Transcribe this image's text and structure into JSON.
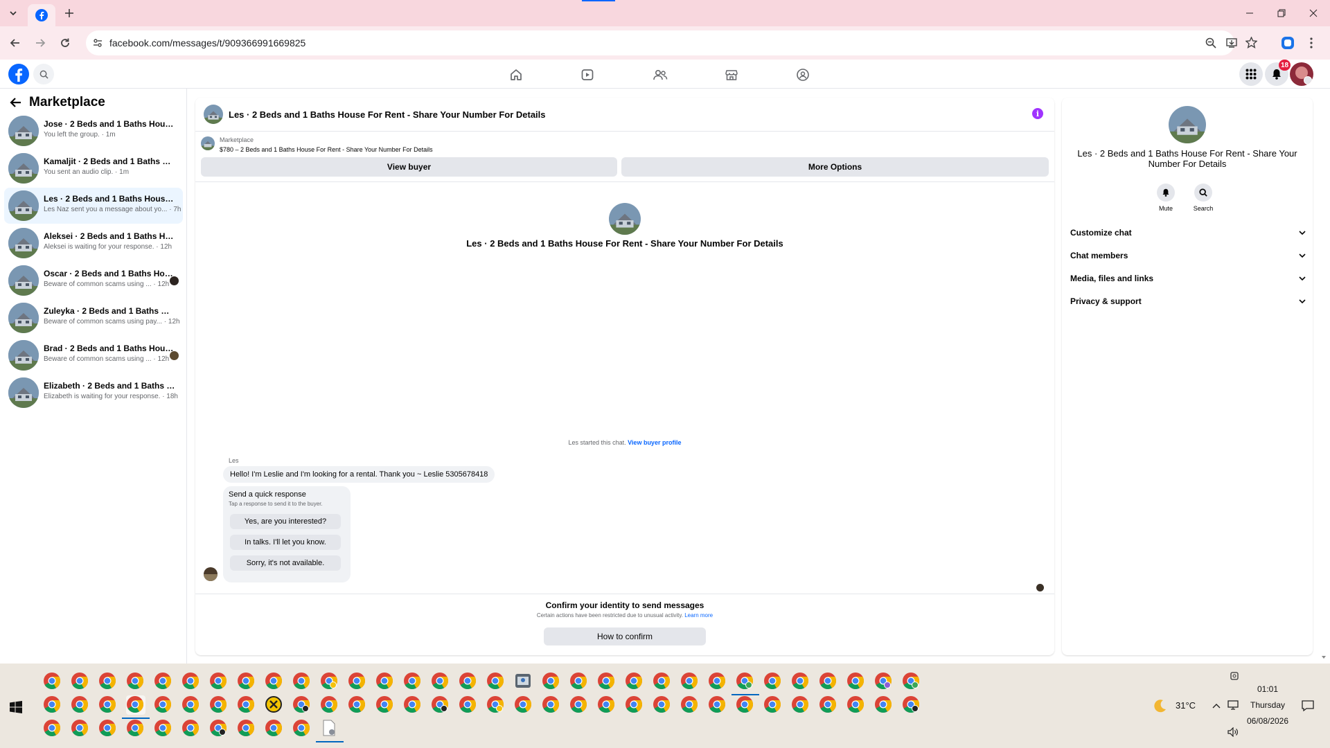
{
  "browser": {
    "url": "facebook.com/messages/t/909366991669825",
    "tab_icon": "facebook-icon"
  },
  "fb": {
    "notification_count": "18"
  },
  "sidebar": {
    "title": "Marketplace",
    "conversations": [
      {
        "title": "Jose · 2 Beds and 1 Baths House Fo...",
        "sub": "You left the group. · 1m",
        "selected": false
      },
      {
        "title": "Kamaljit · 2 Beds and 1 Baths Hous...",
        "sub": "You sent an audio clip. · 1m",
        "selected": false
      },
      {
        "title": "Les · 2 Beds and 1 Baths House For...",
        "sub": "Les Naz sent you a message about yo... · 7h",
        "selected": true
      },
      {
        "title": "Aleksei · 2 Beds and 1 Baths House...",
        "sub": "Aleksei is waiting for your response. · 12h",
        "selected": false
      },
      {
        "title": "Oscar · 2 Beds and 1 Baths Hous...",
        "sub": "Beware of common scams using ... · 12h",
        "selected": false
      },
      {
        "title": "Zuleyka · 2 Beds and 1 Baths Hous...",
        "sub": "Beware of common scams using pay... · 12h",
        "selected": false
      },
      {
        "title": "Brad · 2 Beds and 1 Baths House...",
        "sub": "Beware of common scams using ... · 12h",
        "selected": false
      },
      {
        "title": "Elizabeth · 2 Beds and 1 Baths Hou...",
        "sub": "Elizabeth is waiting for your response. · 18h",
        "selected": false
      }
    ]
  },
  "chat": {
    "header_title": "Les · 2 Beds and 1 Baths House For Rent - Share Your Number For Details",
    "listing_source": "Marketplace",
    "listing_detail": "$780 – 2 Beds and 1 Baths House For Rent - Share Your Number For Details",
    "view_buyer": "View buyer",
    "more_options": "More Options",
    "intro_title": "Les · 2 Beds and 1 Baths House For Rent - Share Your Number For Details",
    "started_text": "Les started this chat.",
    "view_buyer_profile": "View buyer profile",
    "sender_name": "Les",
    "message": "Hello! I'm Leslie and I'm looking for a rental. Thank you ~ Leslie 5305678418",
    "quick_title": "Send a quick response",
    "quick_sub": "Tap a response to send it to the buyer.",
    "quick_responses": [
      "Yes, are you interested?",
      "In talks. I'll let you know.",
      "Sorry, it's not available."
    ],
    "confirm_title": "Confirm your identity to send messages",
    "confirm_sub": "Certain actions have been restricted due to unusual activity.",
    "learn_more": "Learn more",
    "how_to_confirm": "How to confirm"
  },
  "details": {
    "title": "Les · 2 Beds and 1 Baths House For Rent - Share Your Number For Details",
    "mute": "Mute",
    "search": "Search",
    "sections": [
      "Customize chat",
      "Chat members",
      "Media, files and links",
      "Privacy & support"
    ]
  },
  "taskbar": {
    "weather": "31°C",
    "time": "01:01",
    "day": "Thursday",
    "date": "06/08/2026"
  },
  "colors": {
    "accent": "#0866ff",
    "tab_strip": "#f8d7de",
    "selected_row": "#ebf5ff",
    "info_purple": "#a033ff"
  }
}
